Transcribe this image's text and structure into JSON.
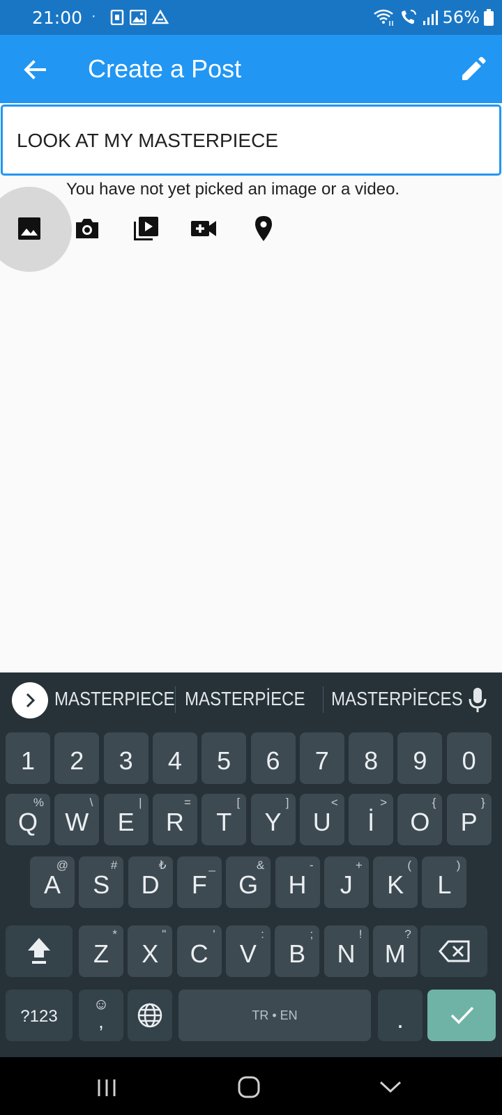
{
  "status_bar": {
    "time": "21:00",
    "dot": "·",
    "battery": "56%",
    "icons": [
      "kakao-notification-icon",
      "gallery-icon",
      "drive-icon",
      "wifi-icon",
      "wifi-call-icon",
      "signal-icon",
      "battery-icon"
    ]
  },
  "app_bar": {
    "title": "Create a Post",
    "back_icon": "arrow-back-icon",
    "action_icon": "pencil-icon",
    "color": "#2196f3"
  },
  "post": {
    "text": "LOOK AT MY MASTERPIECE",
    "media_hint": "You have not yet picked an image or a video."
  },
  "tools": [
    "image-icon",
    "camera-icon",
    "video-library-icon",
    "video-camera-add-icon",
    "location-pin-icon"
  ],
  "keyboard": {
    "suggestions": [
      "MASTERPIECE",
      "MASTERPİECE",
      "MASTERPİECES"
    ],
    "numbers": [
      "1",
      "2",
      "3",
      "4",
      "5",
      "6",
      "7",
      "8",
      "9",
      "0"
    ],
    "row1": [
      {
        "key": "Q",
        "alt": "%"
      },
      {
        "key": "W",
        "alt": "\\"
      },
      {
        "key": "E",
        "alt": "|"
      },
      {
        "key": "R",
        "alt": "="
      },
      {
        "key": "T",
        "alt": "["
      },
      {
        "key": "Y",
        "alt": "]"
      },
      {
        "key": "U",
        "alt": "<"
      },
      {
        "key": "İ",
        "alt": ">"
      },
      {
        "key": "O",
        "alt": "{"
      },
      {
        "key": "P",
        "alt": "}"
      }
    ],
    "row2": [
      {
        "key": "A",
        "alt": "@"
      },
      {
        "key": "S",
        "alt": "#"
      },
      {
        "key": "D",
        "alt": "₺"
      },
      {
        "key": "F",
        "alt": "_"
      },
      {
        "key": "G",
        "alt": "&"
      },
      {
        "key": "H",
        "alt": "-"
      },
      {
        "key": "J",
        "alt": "+"
      },
      {
        "key": "K",
        "alt": "("
      },
      {
        "key": "L",
        "alt": ")"
      }
    ],
    "row3": [
      {
        "key": "Z",
        "alt": "*"
      },
      {
        "key": "X",
        "alt": "\""
      },
      {
        "key": "C",
        "alt": "'"
      },
      {
        "key": "V",
        "alt": ":"
      },
      {
        "key": "B",
        "alt": ";"
      },
      {
        "key": "N",
        "alt": "!"
      },
      {
        "key": "M",
        "alt": "?"
      }
    ],
    "symbols_label": "?123",
    "emoji_key_top": "☺",
    "emoji_key_bottom": ",",
    "space_label": "TR • EN",
    "period": "."
  }
}
